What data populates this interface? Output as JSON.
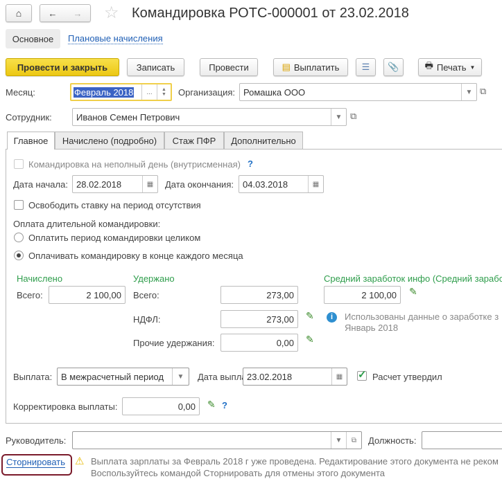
{
  "header": {
    "title": "Командировка РОТС-000001 от 23.02.2018"
  },
  "sections": {
    "main": "Основное",
    "planned": "Плановые начисления"
  },
  "toolbar": {
    "post_close": "Провести и закрыть",
    "save": "Записать",
    "post": "Провести",
    "pay": "Выплатить",
    "print": "Печать"
  },
  "month": {
    "label": "Месяц:",
    "value": "Февраль 2018",
    "dots": "..."
  },
  "org": {
    "label": "Организация:",
    "value": "Ромашка ООО"
  },
  "employee": {
    "label": "Сотрудник:",
    "value": "Иванов Семен Петрович"
  },
  "tabs": [
    "Главное",
    "Начислено (подробно)",
    "Стаж ПФР",
    "Дополнительно"
  ],
  "main": {
    "partial_day": "Командировка на неполный день (внутрисменная)",
    "help": "?",
    "start_label": "Дата начала:",
    "start": "28.02.2018",
    "end_label": "Дата окончания:",
    "end": "04.03.2018",
    "free_rate": "Освободить ставку на период отсутствия",
    "long_trip": "Оплата длительной командировки:",
    "radio1": "Оплатить период командировки целиком",
    "radio2": "Оплачивать командировку в конце каждого месяца",
    "accrued": "Начислено",
    "withheld": "Удержано",
    "avg": "Средний заработок инфо (Средний заработ",
    "total_label": "Всего:",
    "accrued_total": "2 100,00",
    "withheld_total": "273,00",
    "avg_value": "2 100,00",
    "ndfl_label": "НДФЛ:",
    "ndfl": "273,00",
    "other_label": "Прочие удержания:",
    "other": "0,00",
    "info1": "Использованы данные о заработке з",
    "info2": "Январь 2018",
    "payout_label": "Выплата:",
    "payout": "В межрасчетный период",
    "pay_date_label": "Дата выплаты:",
    "pay_date": "23.02.2018",
    "approved": "Расчет утвердил",
    "correction_label": "Корректировка выплаты:",
    "correction": "0,00"
  },
  "footer": {
    "head_label": "Руководитель:",
    "position_label": "Должность:",
    "storno": "Сторнировать",
    "warn1": "Выплата зарплаты за Февраль 2018 г уже проведена. Редактирование этого документа не реком",
    "warn2": "Воспользуйтесь командой Сторнировать для отмены этого документа"
  }
}
